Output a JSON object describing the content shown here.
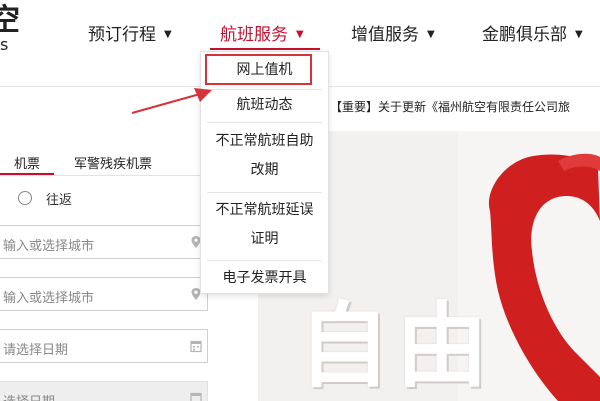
{
  "header": {
    "logo_char": "空",
    "logo_sub": "s",
    "nav": [
      {
        "label": "预订行程"
      },
      {
        "label": "航班服务"
      },
      {
        "label": "增值服务"
      },
      {
        "label": "金鹏俱乐部"
      }
    ]
  },
  "dropdown": {
    "items": [
      {
        "label": "网上值机"
      },
      {
        "label": "航班动态"
      },
      {
        "label_line1": "不正常航班自助",
        "label_line2": "改期"
      },
      {
        "label_line1": "不正常航班延误",
        "label_line2": "证明"
      },
      {
        "label": "电子发票开具"
      }
    ]
  },
  "notice": {
    "text": "【重要】关于更新《福州航空有限责任公司旅"
  },
  "booking": {
    "tabs": [
      {
        "label": "机票"
      },
      {
        "label": "军警残疾机票"
      }
    ],
    "trip_option": "往返",
    "origin_placeholder": "输入或选择城市",
    "destination_placeholder": "输入或选择城市",
    "depart_placeholder": "请选择日期",
    "return_placeholder": "选择日期"
  },
  "hero": {
    "text": "自由",
    "accent_color": "#d01f1f"
  },
  "colors": {
    "brand_red": "#c8102e",
    "highlight_red": "#d6343a"
  }
}
